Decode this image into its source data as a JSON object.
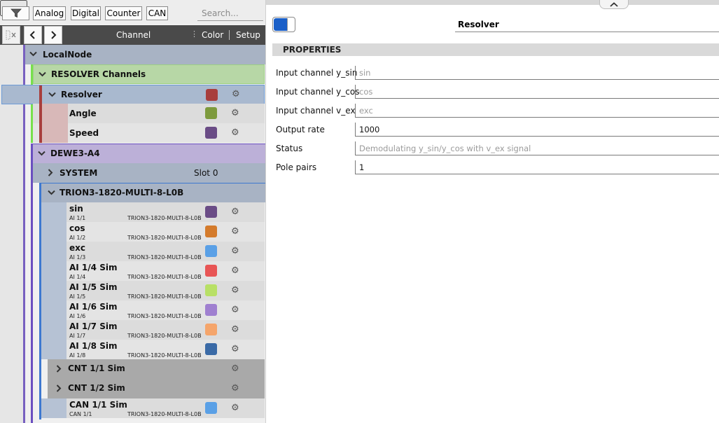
{
  "filter_buttons": {
    "analog": "Analog",
    "digital": "Digital",
    "counter": "Counter",
    "can": "CAN"
  },
  "search": {
    "placeholder": "Search..."
  },
  "columns": {
    "channel": "Channel",
    "color": "Color",
    "setup": "Setup"
  },
  "tree": {
    "local_node": "LocalNode",
    "resolver_group": "RESOLVER Channels",
    "resolver": {
      "name": "Resolver",
      "color": "#a83e3d"
    },
    "angle": {
      "name": "Angle",
      "color": "#7d9a3d"
    },
    "speed": {
      "name": "Speed",
      "color": "#6a4c86"
    },
    "device": "DEWE3-A4",
    "system": {
      "name": "SYSTEM",
      "slot": "Slot 0"
    },
    "trion": "TRION3-1820-MULTI-8-L0B",
    "channels": [
      {
        "name": "sin",
        "sub": "AI 1/1",
        "module": "TRION3-1820-MULTI-8-L0B",
        "color": "#6a4c86"
      },
      {
        "name": "cos",
        "sub": "AI 1/2",
        "module": "TRION3-1820-MULTI-8-L0B",
        "color": "#d47b2c"
      },
      {
        "name": "exc",
        "sub": "AI 1/3",
        "module": "TRION3-1820-MULTI-8-L0B",
        "color": "#5aa0e6"
      },
      {
        "name": "AI 1/4 Sim",
        "sub": "AI 1/4",
        "module": "TRION3-1820-MULTI-8-L0B",
        "color": "#e85555"
      },
      {
        "name": "AI 1/5 Sim",
        "sub": "AI 1/5",
        "module": "TRION3-1820-MULTI-8-L0B",
        "color": "#b8e066"
      },
      {
        "name": "AI 1/6 Sim",
        "sub": "AI 1/6",
        "module": "TRION3-1820-MULTI-8-L0B",
        "color": "#a080d0"
      },
      {
        "name": "AI 1/7 Sim",
        "sub": "AI 1/7",
        "module": "TRION3-1820-MULTI-8-L0B",
        "color": "#f5a56b"
      },
      {
        "name": "AI 1/8 Sim",
        "sub": "AI 1/8",
        "module": "TRION3-1820-MULTI-8-L0B",
        "color": "#3a6aa6"
      }
    ],
    "cnt1": "CNT 1/1 Sim",
    "cnt2": "CNT 1/2 Sim",
    "can": {
      "name": "CAN 1/1 Sim",
      "sub": "CAN 1/1",
      "module": "TRION3-1820-MULTI-8-L0B",
      "color": "#5aa0e6"
    }
  },
  "detail": {
    "title": "Resolver",
    "section": "PROPERTIES",
    "properties": [
      {
        "label": "Input channel y_sin",
        "value": "sin"
      },
      {
        "label": "Input channel y_cos",
        "value": "cos"
      },
      {
        "label": "Input channel v_ex",
        "value": "exc"
      },
      {
        "label": "Output rate",
        "value": "1000"
      },
      {
        "label": "Status",
        "value": "Demodulating y_sin/y_cos with v_ex signal"
      },
      {
        "label": "Pole pairs",
        "value": "1"
      }
    ]
  }
}
